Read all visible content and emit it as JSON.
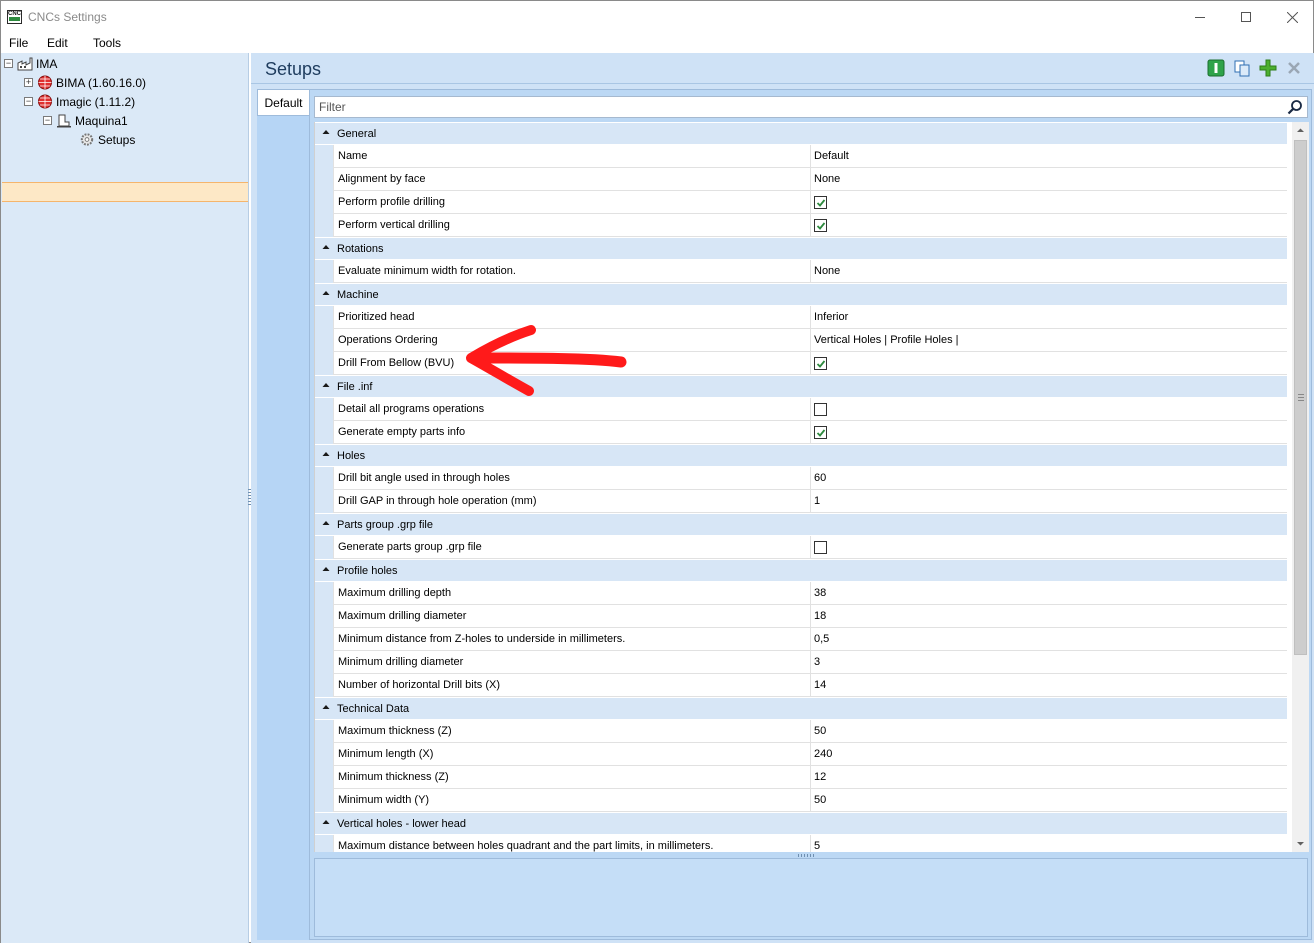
{
  "window": {
    "title": "CNCs Settings",
    "app_icon_text": "CNC"
  },
  "menu": [
    "File",
    "Edit",
    "Tools"
  ],
  "tree": {
    "root": "IMA",
    "children": [
      {
        "label": "BIMA (1.60.16.0)"
      },
      {
        "label": "Imagic (1.11.2)"
      },
      {
        "label": "Maquina1"
      },
      {
        "label": "Setups"
      }
    ],
    "selected": "Setups"
  },
  "panel": {
    "title": "Setups",
    "tab": "Default",
    "filter_placeholder": "Filter",
    "toolbar_icons": [
      "info-icon",
      "copy-icon",
      "add-icon",
      "delete-icon"
    ]
  },
  "colors": {
    "accent": "#1e3c5e",
    "check": "#2d8a3e",
    "arrow": "#ff0000",
    "selection": "#fde8c6"
  },
  "properties": [
    {
      "category": "General",
      "items": [
        {
          "name": "Name",
          "value": "Default"
        },
        {
          "name": "Alignment by face",
          "value": "None"
        },
        {
          "name": "Perform profile drilling",
          "checked": true
        },
        {
          "name": "Perform vertical drilling",
          "checked": true
        }
      ]
    },
    {
      "category": "Rotations",
      "items": [
        {
          "name": "Evaluate minimum width for rotation.",
          "value": "None"
        }
      ]
    },
    {
      "category": "Machine",
      "items": [
        {
          "name": "Prioritized head",
          "value": "Inferior"
        },
        {
          "name": "Operations Ordering",
          "value": "Vertical Holes | Profile Holes |"
        },
        {
          "name": "Drill From Bellow (BVU)",
          "checked": true
        }
      ]
    },
    {
      "category": "File .inf",
      "items": [
        {
          "name": "Detail all programs operations",
          "checked": false
        },
        {
          "name": "Generate empty parts info",
          "checked": true
        }
      ]
    },
    {
      "category": "Holes",
      "items": [
        {
          "name": "Drill bit angle used in through holes",
          "value": "60"
        },
        {
          "name": "Drill GAP in through hole operation (mm)",
          "value": "1"
        }
      ]
    },
    {
      "category": "Parts group .grp file",
      "items": [
        {
          "name": "Generate parts group .grp file",
          "checked": false
        }
      ]
    },
    {
      "category": "Profile holes",
      "items": [
        {
          "name": "Maximum drilling depth",
          "value": "38"
        },
        {
          "name": "Maximum drilling diameter",
          "value": "18"
        },
        {
          "name": "Minimum distance from Z-holes to underside in millimeters.",
          "value": "0,5"
        },
        {
          "name": "Minimum drilling diameter",
          "value": "3"
        },
        {
          "name": "Number of horizontal Drill bits (X)",
          "value": "14"
        }
      ]
    },
    {
      "category": "Technical Data",
      "items": [
        {
          "name": "Maximum thickness (Z)",
          "value": "50"
        },
        {
          "name": "Minimum length (X)",
          "value": "240"
        },
        {
          "name": "Minimum thickness (Z)",
          "value": "12"
        },
        {
          "name": "Minimum width (Y)",
          "value": "50"
        }
      ]
    },
    {
      "category": "Vertical holes - lower head",
      "items": [
        {
          "name": "Maximum distance between holes quadrant and the part limits, in millimeters.",
          "value": "5"
        }
      ]
    }
  ]
}
